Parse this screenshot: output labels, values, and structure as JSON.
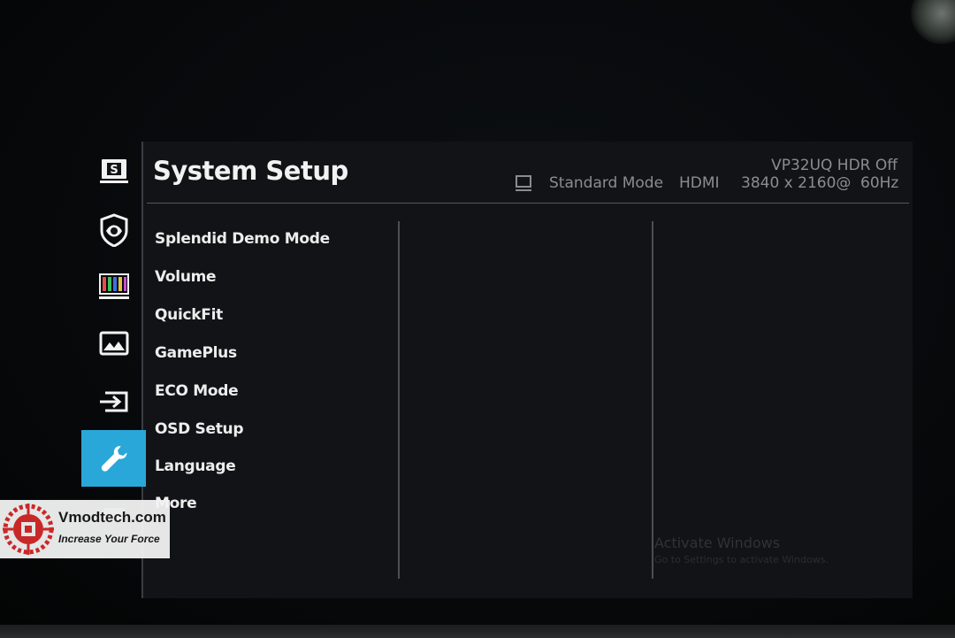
{
  "osd": {
    "title": "System Setup",
    "model_status": "VP32UQ HDR Off",
    "status": {
      "mode_icon": "monitor-icon",
      "mode": "Standard Mode",
      "input": "HDMI",
      "resolution": "3840 x 2160@",
      "refresh": "60Hz"
    }
  },
  "sidebar": {
    "items": [
      {
        "icon": "splendid-icon",
        "active": false
      },
      {
        "icon": "eye-care-icon",
        "active": false
      },
      {
        "icon": "color-icon",
        "active": false
      },
      {
        "icon": "image-icon",
        "active": false
      },
      {
        "icon": "input-select-icon",
        "active": false
      },
      {
        "icon": "wrench-icon",
        "active": true
      },
      {
        "icon": "shortcut-icon",
        "active": false
      }
    ]
  },
  "menu": {
    "items": [
      {
        "label": "Splendid Demo Mode"
      },
      {
        "label": "Volume"
      },
      {
        "label": "QuickFit"
      },
      {
        "label": "GamePlus"
      },
      {
        "label": "ECO Mode"
      },
      {
        "label": "OSD Setup"
      },
      {
        "label": "Language"
      },
      {
        "label": "More"
      }
    ]
  },
  "windows_watermark": {
    "title": "Activate Windows",
    "subtitle": "Go to Settings to activate Windows."
  },
  "logo": {
    "name": "Vmodtech.com",
    "tagline": "Increase Your Force"
  },
  "colors": {
    "accent": "#2aa7d9",
    "osd_background": "#121316",
    "text": "#ededed",
    "status_text": "#8a8d90"
  }
}
